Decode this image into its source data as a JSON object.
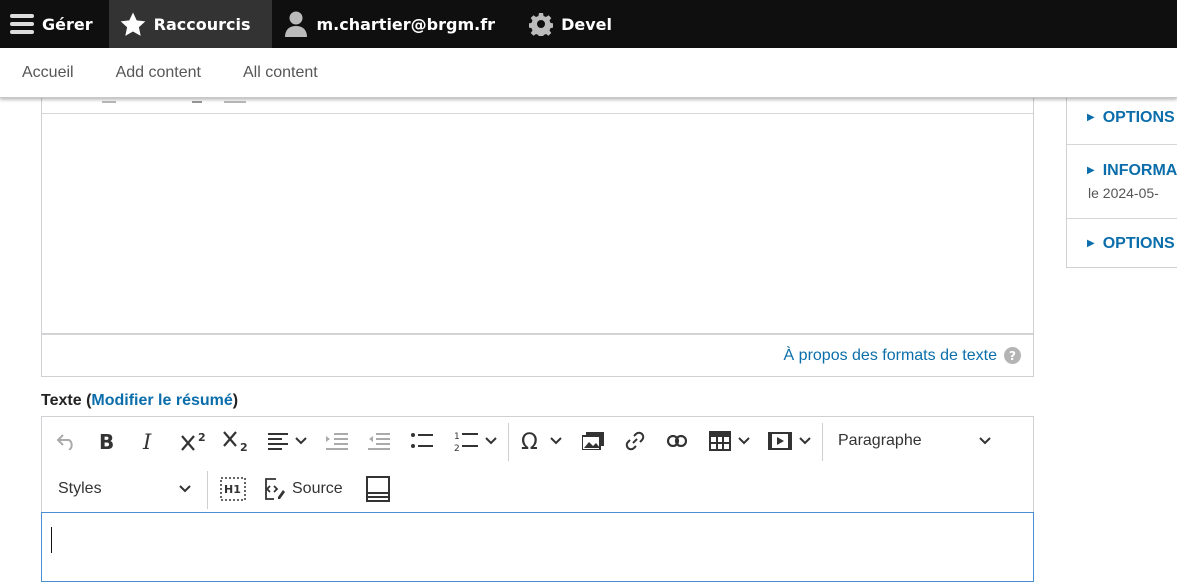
{
  "toolbar": {
    "manage_label": "Gérer",
    "shortcuts_label": "Raccourcis",
    "user_label": "m.chartier@brgm.fr",
    "devel_label": "Devel"
  },
  "tray": {
    "links": [
      "Accueil",
      "Add content",
      "All content"
    ]
  },
  "previous_field": {
    "formats_link": "À propos des formats de texte",
    "help_glyph": "?"
  },
  "body_field": {
    "label": "Texte",
    "summary_link": "Modifier le résumé",
    "paren_open": "(",
    "paren_close": ")",
    "heading_dropdown": "Paragraphe",
    "styles_dropdown": "Styles",
    "source_label": "Source"
  },
  "sidebar": {
    "items": [
      {
        "title": "OPTIONS"
      },
      {
        "title": "INFORMA",
        "subtitle": "le 2024-05-"
      },
      {
        "title": "OPTIONS"
      }
    ]
  },
  "colors": {
    "link": "#0b6eab",
    "toolbar_bg": "#0f0f0f",
    "active_tab": "#333333",
    "editor_focus": "#4b8fd3"
  }
}
